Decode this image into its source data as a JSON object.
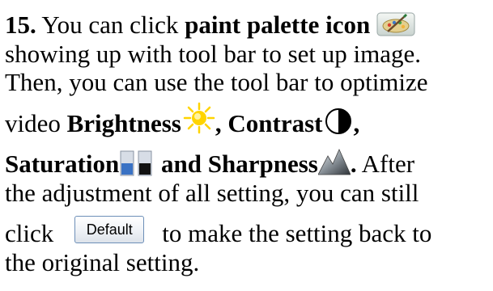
{
  "step": {
    "number": "15.",
    "line1_text": " You can click ",
    "line1_bold": "paint palette icon",
    "line2": "showing up with tool bar to set up image.",
    "line3": "Then, you can use the tool bar to optimize",
    "line4_text": "video ",
    "brightness": "Brightness",
    "comma1": ", ",
    "contrast": "Contrast",
    "comma2": ",",
    "saturation": "Saturation",
    "and_sharpness": " and Sharpness",
    "period": ".",
    "after": " After",
    "line6": "the adjustment of all setting, you can still",
    "click": "click",
    "default_button": "Default",
    "line7_rest": "to make the setting back to",
    "line8": "the original setting."
  },
  "icons": {
    "palette": "paint-palette-icon",
    "brightness": "sun-icon",
    "contrast": "contrast-icon",
    "saturation": "saturation-icon",
    "sharpness": "sharpness-icon"
  },
  "colors": {
    "sun": "#ffd400",
    "saturation_blue": "#3a72c4",
    "button_border": "#6d8fb8"
  }
}
